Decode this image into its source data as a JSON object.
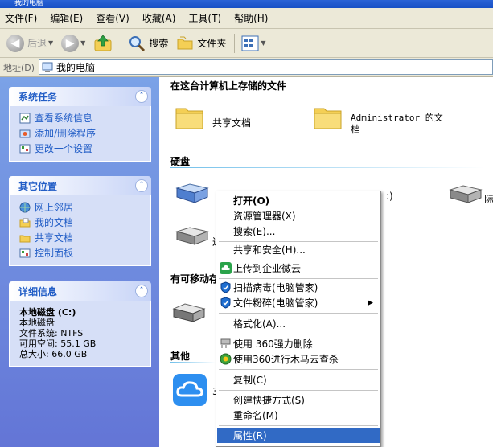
{
  "window": {
    "title": "我的电脑"
  },
  "menubar": [
    {
      "label": "文件(F)"
    },
    {
      "label": "编辑(E)"
    },
    {
      "label": "查看(V)"
    },
    {
      "label": "收藏(A)"
    },
    {
      "label": "工具(T)"
    },
    {
      "label": "帮助(H)"
    }
  ],
  "toolbar": {
    "back_label": "后退",
    "search_label": "搜索",
    "folders_label": "文件夹"
  },
  "address": {
    "label": "地址(D)",
    "value": "我的电脑"
  },
  "left_panels": {
    "system_tasks": {
      "title": "系统任务",
      "items": [
        {
          "label": "查看系统信息"
        },
        {
          "label": "添加/删除程序"
        },
        {
          "label": "更改一个设置"
        }
      ]
    },
    "other_places": {
      "title": "其它位置",
      "items": [
        {
          "label": "网上邻居"
        },
        {
          "label": "我的文档"
        },
        {
          "label": "共享文档"
        },
        {
          "label": "控制面板"
        }
      ]
    },
    "details": {
      "title": "详细信息",
      "name": "本地磁盘 (C:)",
      "type": "本地磁盘",
      "filesystem": "文件系统: NTFS",
      "free": "可用空间: 55.1 GB",
      "total": "总大小: 66.0 GB"
    }
  },
  "content": {
    "group_stored": "在这台计算机上存储的文件",
    "shared_docs": "共享文档",
    "admin_docs_1": "Administrator 的文",
    "admin_docs_2": "档",
    "group_hdd": "硬盘",
    "partial_c": ":)",
    "partial_r": "际",
    "partial_d": "过",
    "group_removable": "有可移动存",
    "group_other": "其他",
    "partial_cloud": "3"
  },
  "context_menu": [
    {
      "label": "打开(O)",
      "bold": true
    },
    {
      "label": "资源管理器(X)"
    },
    {
      "label": "搜索(E)..."
    },
    {
      "label": "共享和安全(H)..."
    },
    {
      "label": "上传到企业微云"
    },
    {
      "label": "扫描病毒(电脑管家)"
    },
    {
      "label": "文件粉碎(电脑管家)"
    },
    {
      "label": "格式化(A)..."
    },
    {
      "label": "使用 360强力删除"
    },
    {
      "label": "使用360进行木马云查杀"
    },
    {
      "label": "复制(C)"
    },
    {
      "label": "创建快捷方式(S)"
    },
    {
      "label": "重命名(M)"
    },
    {
      "label": "属性(R)"
    }
  ],
  "colors": {
    "title_blue": "#215dc6",
    "pane_top": "#7ba2e7",
    "pane_bottom": "#6375d6",
    "toolbar_bg": "#ece9d8",
    "highlight": "#316ac5"
  }
}
